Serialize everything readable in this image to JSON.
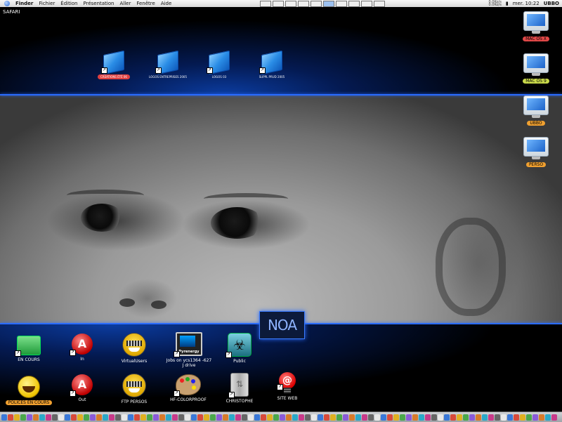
{
  "menubar": {
    "app": "Finder",
    "items": [
      "Fichier",
      "Édition",
      "Présentation",
      "Aller",
      "Fenêtre",
      "Aide"
    ],
    "clock": "mer. 10:22",
    "user": "UBBO",
    "net_in": "0.0Ko/s",
    "net_out": "0.0Ko/s",
    "input_flag": "French"
  },
  "desktop": {
    "corner_label": "SAFARI",
    "banner": "NOA",
    "top_folders": [
      {
        "label": "CREATIONS ÉTÉ 06",
        "label_color": "#e04040"
      },
      {
        "label": "LOGOS ENTREPRISES 2005",
        "label_color": ""
      },
      {
        "label": "LOGOS 03",
        "label_color": ""
      },
      {
        "label": "SUPPL PRUD 2005",
        "label_color": ""
      }
    ],
    "volumes": [
      {
        "label": "MAC OS X",
        "label_color": "#e04848"
      },
      {
        "label": "MAC OS 9",
        "label_color": "#c8d84a"
      },
      {
        "label": "UBBO",
        "label_color": "#f0a030"
      },
      {
        "label": "PERSO",
        "label_color": "#f0a030"
      }
    ],
    "row1": [
      {
        "label": "EN COURS",
        "icon": "grid-app-icon"
      },
      {
        "label": "In",
        "icon": "pdf-icon"
      },
      {
        "label": "VirtualUsers",
        "icon": "knight-helmet-icon"
      },
      {
        "label": "Jobs on ycs1364 -627 J drive",
        "icon": "pyrenergy-icon",
        "icon_text": "Pyrenergy"
      },
      {
        "label": "Public",
        "icon": "biohazard-icon"
      }
    ],
    "row2": [
      {
        "label": "POLICES EN COURS",
        "icon": "smiley-icon",
        "label_color": "#f0a030"
      },
      {
        "label": "Out",
        "icon": "pdf-icon"
      },
      {
        "label": "FTP PERSOS",
        "icon": "knight-helmet-icon"
      },
      {
        "label": "HF-COLORPROOF",
        "icon": "paint-palette-icon"
      },
      {
        "label": "CHRISTOPHE",
        "icon": "hard-drive-icon"
      },
      {
        "label": "SITE WEB",
        "icon": "web-at-icon"
      }
    ]
  }
}
